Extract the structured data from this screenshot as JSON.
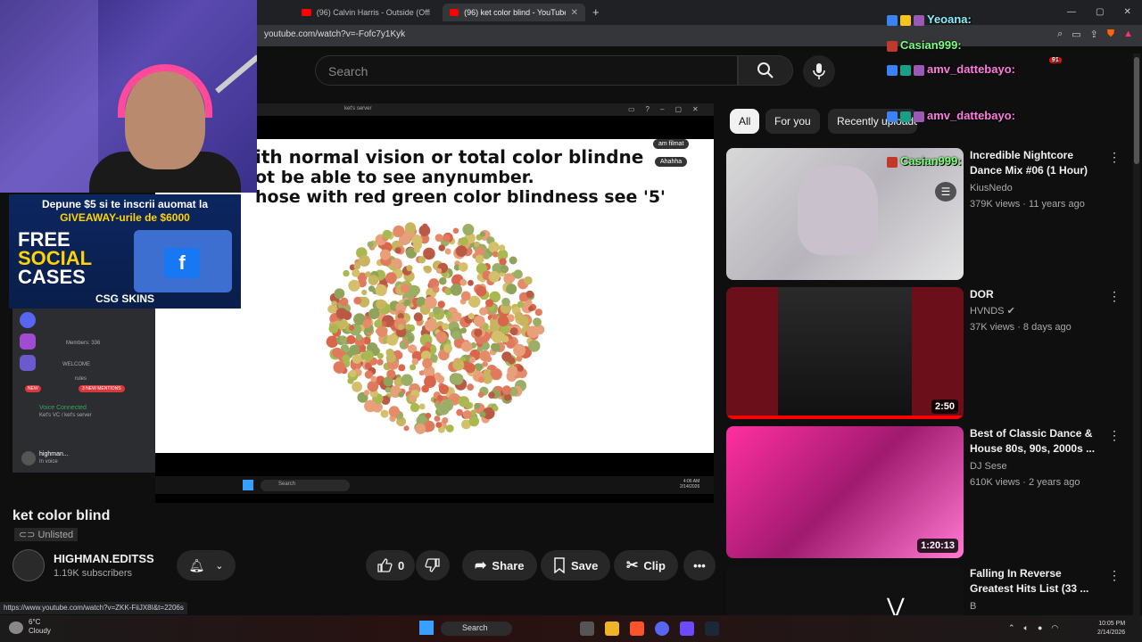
{
  "browser": {
    "tabs": [
      {
        "label": "(96) Calvin Harris - Outside (Official V",
        "active": false
      },
      {
        "label": "(96) ket color blind - YouTube",
        "active": true
      }
    ],
    "new_tab": "+",
    "url": "youtube.com/watch?v=-Fofc7y1Kyk",
    "status_url": "https://www.youtube.com/watch?v=ZKK-FiiJX8I&t=2206s"
  },
  "header": {
    "search_placeholder": "Search"
  },
  "player": {
    "inner_title": "ket's server",
    "slide_lines": [
      "ith normal vision or total color blindne",
      "ot be able to see anynumber.",
      "hose with red green color blindness see  '5'"
    ],
    "comment_tags": [
      "am filmat",
      "Ahahha"
    ],
    "inner_search": "Search",
    "inner_clock": [
      "4:06 AM",
      "2/14/2026"
    ]
  },
  "video": {
    "title": "ket color blind",
    "visibility": "Unlisted",
    "channel": "HIGHMAN.EDITSS",
    "subscribers": "1.19K subscribers",
    "likes": "0",
    "share": "Share",
    "save": "Save",
    "clip": "Clip"
  },
  "chips": [
    {
      "label": "All",
      "active": true
    },
    {
      "label": "For you",
      "active": false
    },
    {
      "label": "Recently uploaded",
      "active": false
    }
  ],
  "recommendations": [
    {
      "title": "Incredible Nightcore Dance Mix #06 (1 Hour)",
      "channel": "KiusNedo",
      "meta": "379K views · 11 years ago",
      "duration": ""
    },
    {
      "title": "DOR",
      "channel": "HVNDS",
      "meta": "37K views · 8 days ago",
      "duration": "2:50"
    },
    {
      "title": "Best of Classic Dance & House 80s, 90s, 2000s ...",
      "channel": "DJ Sese",
      "meta": "610K views · 2 years ago",
      "duration": "1:20:13"
    },
    {
      "title": "Falling In Reverse Greatest Hits List (33 ...",
      "channel": "B",
      "meta": "",
      "duration": ""
    }
  ],
  "overlay": {
    "promo_line1": "Depune $5 si te inscrii auomat la",
    "promo_line2": "GIVEAWAY-urile de $6000",
    "promo_free": "FREE",
    "promo_social": "SOCIAL",
    "promo_cases": "CASES",
    "promo_brand": "CSG SKINS",
    "discord_members": "Members: 336",
    "discord_welcome": "WELCOME",
    "discord_rules": "rules",
    "discord_mentions": "3 NEW MENTIONS",
    "discord_new": "NEW",
    "discord_voice": "Voice Connected",
    "discord_voice_sub": "Ket's VC / ket's server",
    "discord_user": "highman...",
    "discord_user_status": "In voice",
    "chat": [
      {
        "user": "Yeoana:",
        "color": "#8ef0ff"
      },
      {
        "user": "Casian999:",
        "color": "#7dff7d"
      },
      {
        "user": "amv_dattebayo:",
        "color": "#ff7de0"
      },
      {
        "user": "amv_dattebayo:",
        "color": "#ff7de0"
      },
      {
        "user": "Casian999:",
        "color": "#7dff7d"
      }
    ],
    "chat_badge": "91"
  },
  "taskbar": {
    "temp": "6°C",
    "weather": "Cloudy",
    "search": "Search",
    "time": "10:05 PM",
    "date": "2/14/2026"
  }
}
